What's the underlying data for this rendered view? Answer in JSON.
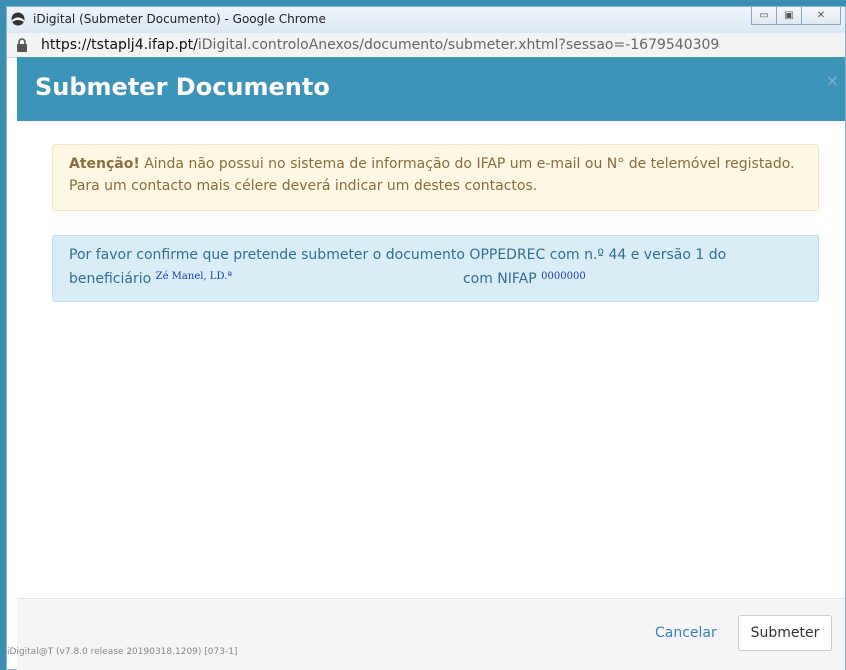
{
  "window": {
    "title": "iDigital (Submeter Documento) - Google Chrome",
    "minimize_icon": "minimize-icon",
    "maximize_icon": "maximize-icon",
    "close_icon": "close-icon"
  },
  "address": {
    "host": "https://tstaplj4.ifap.pt/",
    "path": "iDigital.controloAnexos/documento/submeter.xhtml?sessao=-1679540309"
  },
  "modal": {
    "title": "Submeter Documento",
    "close": "×"
  },
  "warning": {
    "strong": "Atenção!",
    "text": " Ainda não possui no sistema de informação do IFAP um e-mail ou N° de telemóvel registado. Para um contacto mais célere deverá indicar um destes contactos."
  },
  "info": {
    "line1": "Por favor confirme que pretende submeter o documento OPPEDREC com n.º 44 e versão 1 do",
    "beneficiario_label": "beneficiário",
    "beneficiario_value": "Zé Manel, LD.ª",
    "nifap_label": "com NIFAP",
    "nifap_value": "0000000"
  },
  "footer": {
    "cancel_label": "Cancelar",
    "submit_label": "Submeter"
  },
  "version": "iDigital@T (v7.8.0 release 20190318.1209) [073-1]",
  "colors": {
    "header": "#3c94b8",
    "warning_bg": "#fcf8e3",
    "info_bg": "#d9edf7"
  }
}
